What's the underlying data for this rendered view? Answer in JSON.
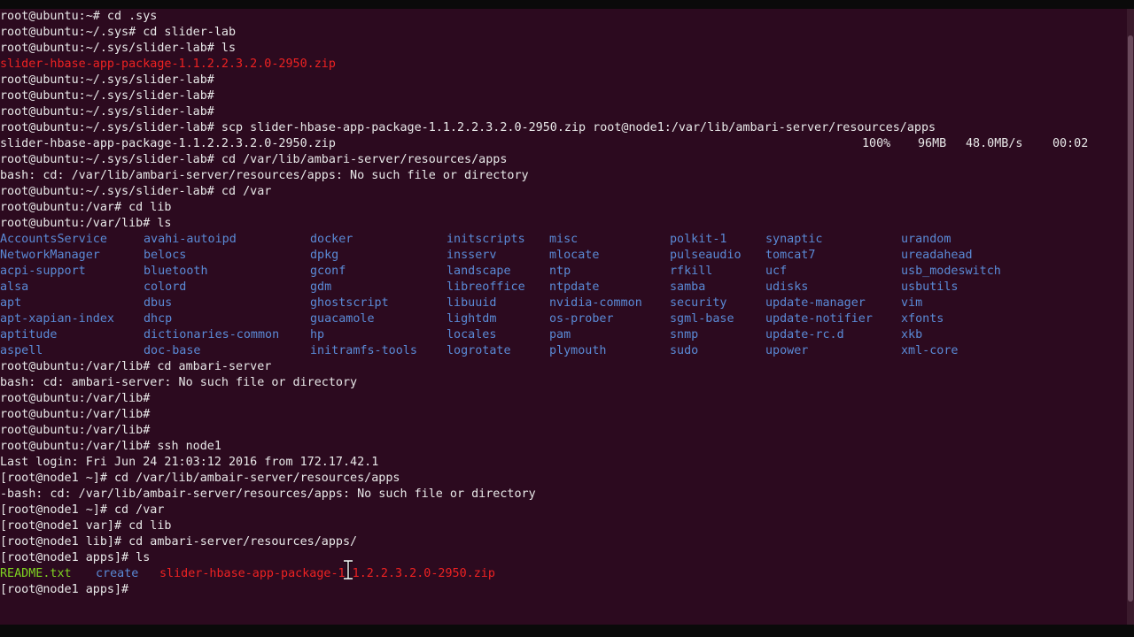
{
  "terminal": {
    "lines_before_listing": [
      "root@ubuntu:~# cd .sys",
      "root@ubuntu:~/.sys# cd slider-lab",
      "root@ubuntu:~/.sys/slider-lab# ls"
    ],
    "zip_file_red": "slider-hbase-app-package-1.1.2.2.3.2.0-2950.zip",
    "lines_after_zip": [
      "root@ubuntu:~/.sys/slider-lab#",
      "root@ubuntu:~/.sys/slider-lab#",
      "root@ubuntu:~/.sys/slider-lab#",
      "root@ubuntu:~/.sys/slider-lab# scp slider-hbase-app-package-1.1.2.2.3.2.0-2950.zip root@node1:/var/lib/ambari-server/resources/apps"
    ],
    "scp_progress": {
      "file": "slider-hbase-app-package-1.1.2.2.3.2.0-2950.zip",
      "percent": "100%",
      "size": "96MB",
      "rate": "48.0MB/s",
      "time": "00:02"
    },
    "lines_mid": [
      "root@ubuntu:~/.sys/slider-lab# cd /var/lib/ambari-server/resources/apps",
      "bash: cd: /var/lib/ambari-server/resources/apps: No such file or directory",
      "root@ubuntu:~/.sys/slider-lab# cd /var",
      "root@ubuntu:/var# cd lib",
      "root@ubuntu:/var/lib# ls"
    ],
    "listing_rows": [
      [
        "AccountsService",
        "avahi-autoipd",
        "docker",
        "initscripts",
        "misc",
        "polkit-1",
        "synaptic",
        "urandom"
      ],
      [
        "NetworkManager",
        "belocs",
        "dpkg",
        "insserv",
        "mlocate",
        "pulseaudio",
        "tomcat7",
        "ureadahead"
      ],
      [
        "acpi-support",
        "bluetooth",
        "gconf",
        "landscape",
        "ntp",
        "rfkill",
        "ucf",
        "usb_modeswitch"
      ],
      [
        "alsa",
        "colord",
        "gdm",
        "libreoffice",
        "ntpdate",
        "samba",
        "udisks",
        "usbutils"
      ],
      [
        "apt",
        "dbus",
        "ghostscript",
        "libuuid",
        "nvidia-common",
        "security",
        "update-manager",
        "vim"
      ],
      [
        "apt-xapian-index",
        "dhcp",
        "guacamole",
        "lightdm",
        "os-prober",
        "sgml-base",
        "update-notifier",
        "xfonts"
      ],
      [
        "aptitude",
        "dictionaries-common",
        "hp",
        "locales",
        "pam",
        "snmp",
        "update-rc.d",
        "xkb"
      ],
      [
        "aspell",
        "doc-base",
        "initramfs-tools",
        "logrotate",
        "plymouth",
        "sudo",
        "upower",
        "xml-core"
      ]
    ],
    "lines_after_listing": [
      "root@ubuntu:/var/lib# cd ambari-server",
      "bash: cd: ambari-server: No such file or directory",
      "root@ubuntu:/var/lib#",
      "root@ubuntu:/var/lib#",
      "root@ubuntu:/var/lib#",
      "root@ubuntu:/var/lib# ssh node1",
      "Last login: Fri Jun 24 21:03:12 2016 from 172.17.42.1",
      "[root@node1 ~]# cd /var/lib/ambair-server/resources/apps",
      "-bash: cd: /var/lib/ambair-server/resources/apps: No such file or directory",
      "[root@node1 ~]# cd /var",
      "[root@node1 var]# cd lib",
      "[root@node1 lib]# cd ambari-server/resources/apps/",
      "[root@node1 apps]# ls"
    ],
    "final_listing": {
      "readme": "README.txt",
      "create": "create",
      "zip": "slider-hbase-app-package-1.1.2.2.3.2.0-2950.zip"
    },
    "final_prompt": "[root@node1 apps]# ",
    "colors": {
      "background": "#2c0a1f",
      "text": "#e8e8e8",
      "archive": "#ee2222",
      "directory": "#5a8ad6",
      "executable_file": "#7ed321"
    }
  }
}
